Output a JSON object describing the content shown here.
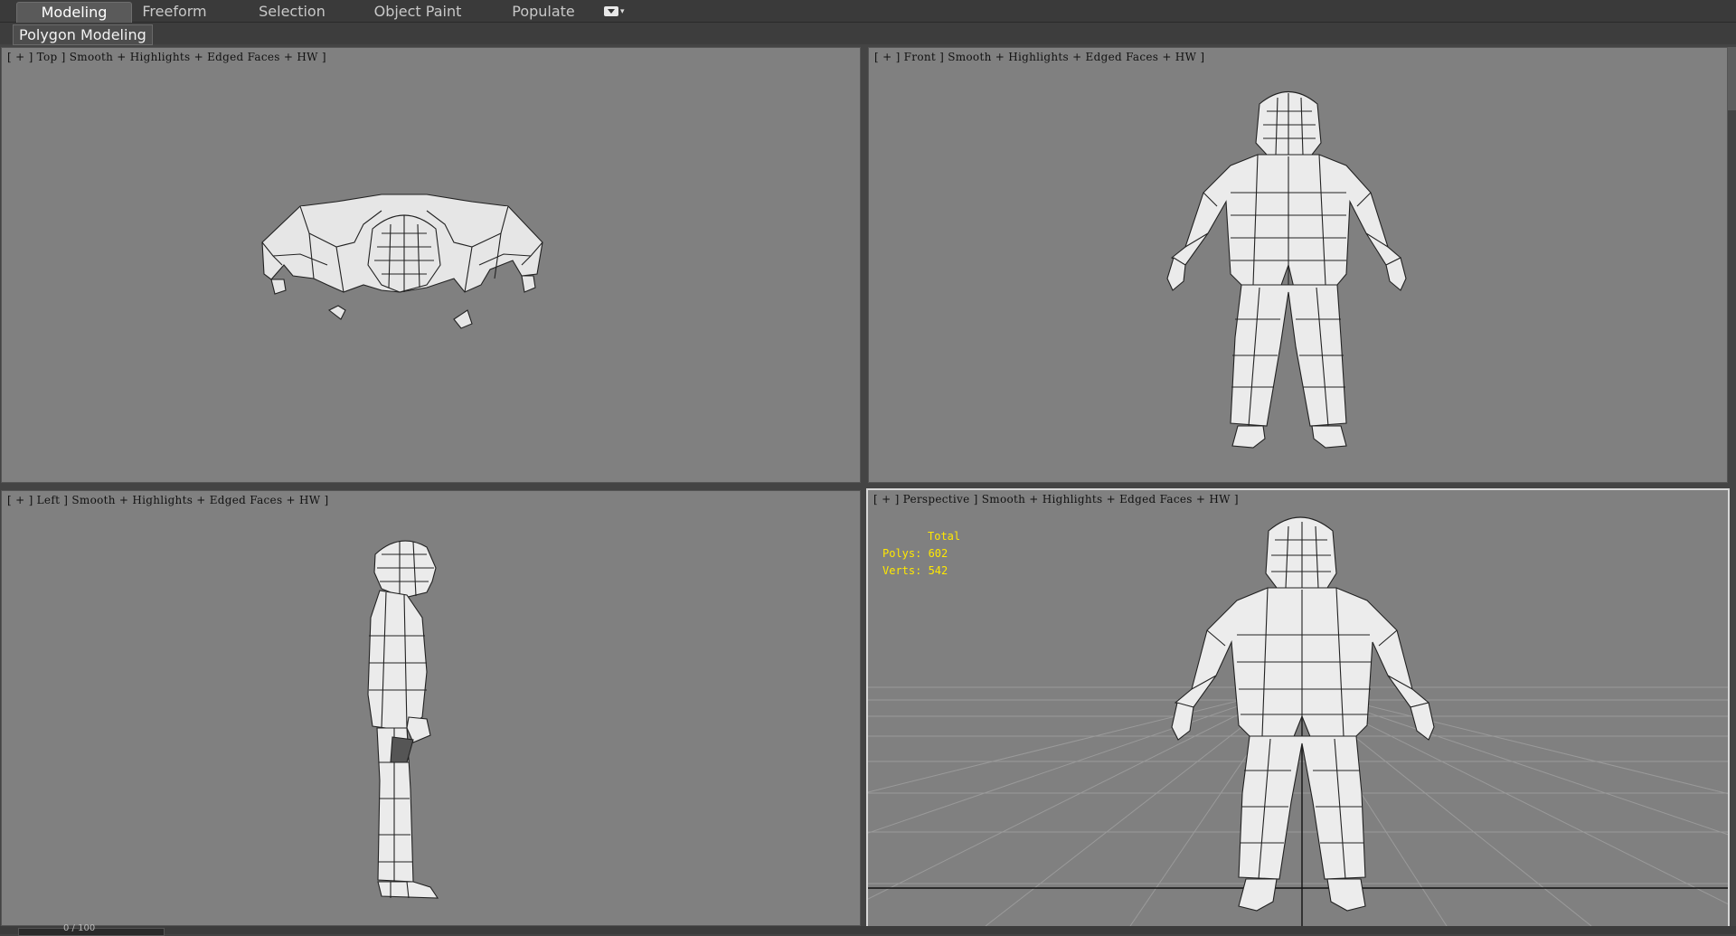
{
  "ribbon": {
    "tabs": [
      {
        "label": "Modeling",
        "active": true
      },
      {
        "label": "Freeform",
        "active": false
      },
      {
        "label": "Selection",
        "active": false
      },
      {
        "label": "Object Paint",
        "active": false
      },
      {
        "label": "Populate",
        "active": false
      }
    ],
    "panel_label": "Polygon Modeling",
    "dropdown_icon": "ribbon-options-icon"
  },
  "viewports": {
    "top": {
      "label": "[ + ] Top ] Smooth + Highlights + Edged Faces + HW ]"
    },
    "front": {
      "label": "[ + ] Front ] Smooth + Highlights + Edged Faces + HW ]"
    },
    "left": {
      "label": "[ + ] Left ] Smooth + Highlights + Edged Faces + HW ]"
    },
    "perspective": {
      "label": "[ + ] Perspective ] Smooth + Highlights + Edged Faces + HW ]"
    }
  },
  "stats": {
    "heading": "Total",
    "polys": "Polys: 602",
    "verts": "Verts: 542"
  },
  "timeline": {
    "frame": "0 / 100"
  },
  "colors": {
    "viewport_bg": "#808080",
    "stats_text": "#ffe800",
    "ui_dark": "#3a3a3a"
  }
}
